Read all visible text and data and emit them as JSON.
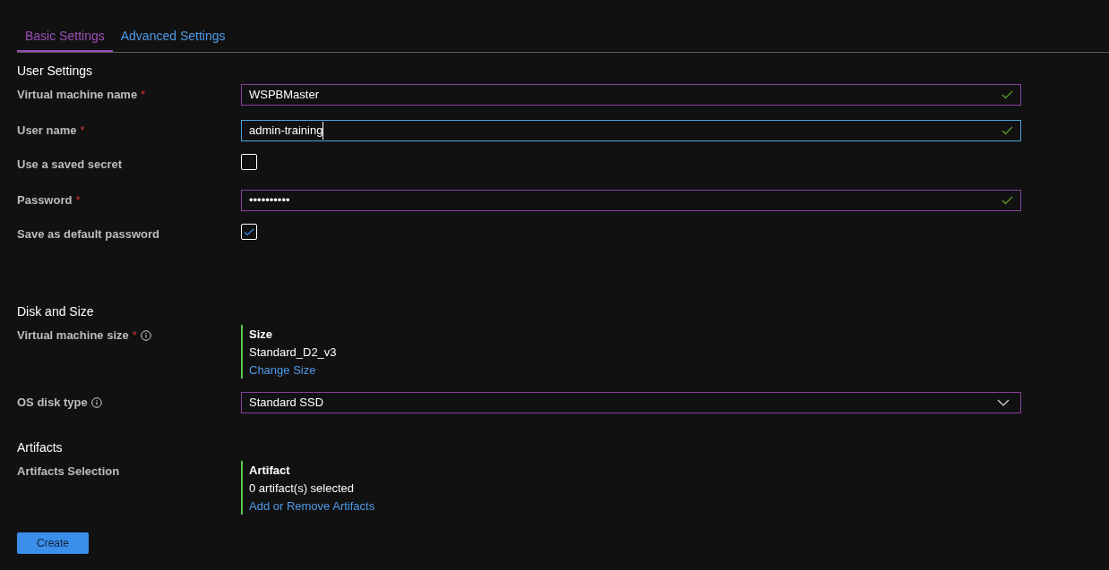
{
  "tabs": [
    {
      "label": "Basic Settings",
      "selected": true
    },
    {
      "label": "Advanced Settings",
      "selected": false
    }
  ],
  "sections": [
    {
      "title": "User Settings",
      "rows": [
        {
          "kind": "text",
          "label": "Virtual machine name",
          "required_mark": "*",
          "value": "WSPBMaster",
          "valid": true,
          "focused": false
        },
        {
          "kind": "text",
          "label": "User name",
          "required_mark": "*",
          "value": "admin-training",
          "valid": true,
          "focused": true
        },
        {
          "kind": "checkbox",
          "label": "Use a saved secret",
          "checked": false
        },
        {
          "kind": "text",
          "label": "Password",
          "required_mark": "*",
          "value": "••••••••••",
          "valid": true,
          "focused": false
        },
        {
          "kind": "checkbox",
          "label": "Save as default password",
          "checked": true
        }
      ]
    },
    {
      "title": "Disk and Size",
      "rows": [
        {
          "kind": "selector",
          "label": "Virtual machine size",
          "required_mark": "*",
          "info": true,
          "heading": "Size",
          "detail": "Standard_D2_v3",
          "link": "Change Size"
        },
        {
          "kind": "dropdown",
          "label": "OS disk type",
          "info": true,
          "value": "Standard SSD"
        }
      ]
    },
    {
      "title": "Artifacts",
      "rows": [
        {
          "kind": "selector",
          "label": "Artifacts Selection",
          "info": false,
          "heading": "Artifact",
          "detail": "0 artifact(s) selected",
          "link": "Add or Remove Artifacts"
        }
      ]
    }
  ],
  "create_button": "Create"
}
